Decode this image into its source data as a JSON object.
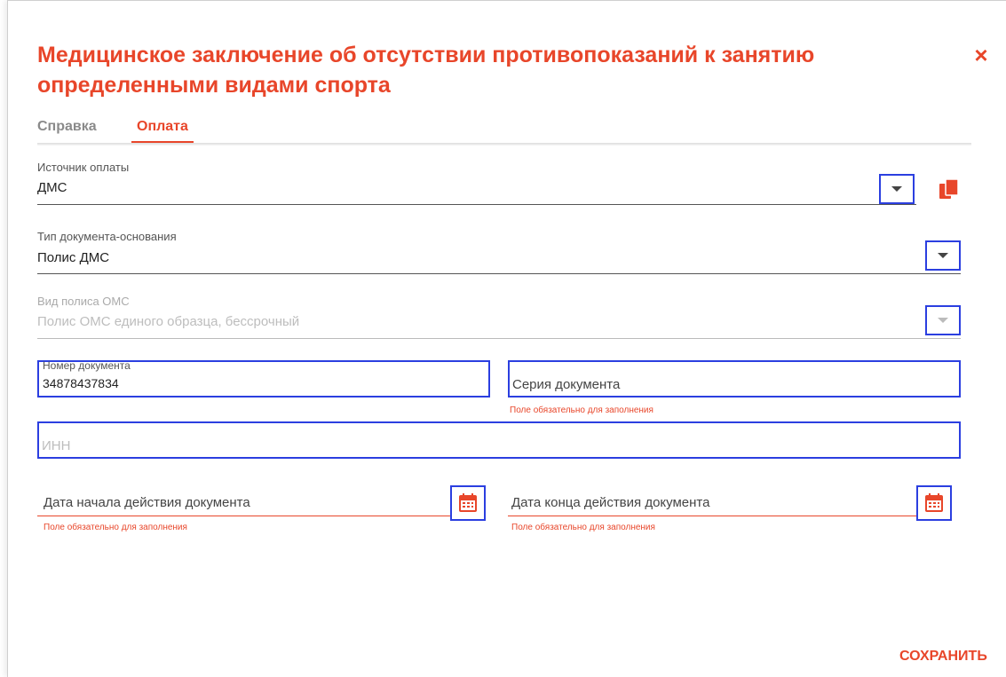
{
  "dialog": {
    "title": "Медицинское заключение об отсутствии противопоказаний к занятию определенными видами спорта",
    "close_symbol": "×"
  },
  "tabs": [
    {
      "label": "Справка",
      "active": false
    },
    {
      "label": "Оплата",
      "active": true
    }
  ],
  "form": {
    "payment_source": {
      "label": "Источник оплаты",
      "value": "ДМС"
    },
    "document_type": {
      "label": "Тип документа-основания",
      "value": "Полис ДМС"
    },
    "oms_policy_type": {
      "label": "Вид полиса ОМС",
      "value": "Полис ОМС единого образца, бессрочный",
      "disabled": true
    },
    "document_number": {
      "label": "Номер документа",
      "value": "34878437834"
    },
    "document_series": {
      "placeholder": "Серия документа",
      "error": "Поле обязательно для заполнения"
    },
    "inn": {
      "placeholder": "ИНН"
    },
    "start_date": {
      "placeholder": "Дата начала действия документа",
      "error": "Поле обязательно для заполнения"
    },
    "end_date": {
      "placeholder": "Дата конца действия документа",
      "error": "Поле обязательно для заполнения"
    }
  },
  "actions": {
    "save_label": "СОХРАНИТЬ"
  },
  "icons": {
    "dropdown": "chevron-down-icon",
    "copy": "copy-icon",
    "calendar": "calendar-icon",
    "close": "close-icon"
  },
  "colors": {
    "accent": "#e8462a",
    "highlight": "#2b3fe0"
  }
}
